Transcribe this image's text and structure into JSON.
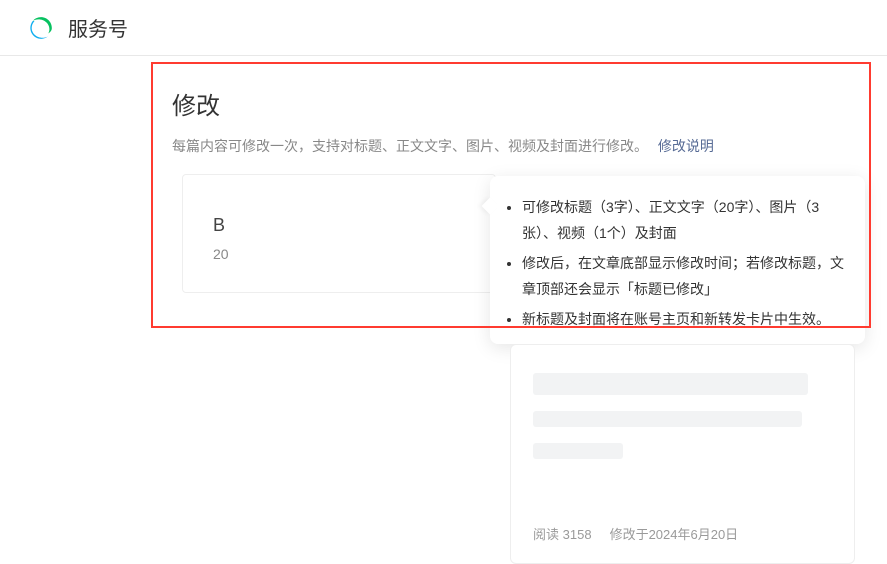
{
  "header": {
    "app_title": "服务号"
  },
  "page": {
    "title": "修改",
    "subtitle": "每篇内容可修改一次，支持对标题、正文文字、图片、视频及封面进行修改。",
    "help_link": "修改说明"
  },
  "article_card": {
    "initial": "B",
    "date_fragment": "20"
  },
  "tooltip": {
    "items": [
      "可修改标题（3字）、正文文字（20字）、图片（3张）、视频（1个）及封面",
      "修改后，在文章底部显示修改时间；若修改标题，文章顶部还会显示「标题已修改」",
      "新标题及封面将在账号主页和新转发卡片中生效。"
    ]
  },
  "preview": {
    "read_label": "阅读",
    "read_count": "3158",
    "modified_label": "修改于2024年6月20日"
  }
}
